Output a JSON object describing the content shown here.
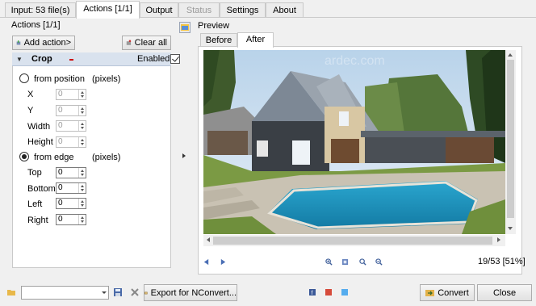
{
  "tabs": [
    {
      "label": "Input: 53 file(s)"
    },
    {
      "label": "Actions [1/1]"
    },
    {
      "label": "Output"
    },
    {
      "label": "Status"
    },
    {
      "label": "Settings"
    },
    {
      "label": "About"
    }
  ],
  "actions_panel": {
    "title": "Actions [1/1]",
    "add_action": "Add action>",
    "clear_all": "Clear all",
    "crop": {
      "name": "Crop",
      "enabled_label": "Enabled",
      "enabled": true,
      "from_position": {
        "label": "from position",
        "unit": "(pixels)",
        "fields": [
          {
            "label": "X",
            "value": "0"
          },
          {
            "label": "Y",
            "value": "0"
          },
          {
            "label": "Width",
            "value": "0"
          },
          {
            "label": "Height",
            "value": "0"
          }
        ]
      },
      "from_edge": {
        "label": "from edge",
        "unit": "(pixels)",
        "fields": [
          {
            "label": "Top",
            "value": "0"
          },
          {
            "label": "Bottom",
            "value": "0"
          },
          {
            "label": "Left",
            "value": "0"
          },
          {
            "label": "Right",
            "value": "0"
          }
        ]
      }
    }
  },
  "preview": {
    "title": "Preview",
    "tabs": [
      {
        "label": "Before"
      },
      {
        "label": "After"
      }
    ],
    "watermark": "ardec.com",
    "counter": "19/53 [51%]"
  },
  "bottom": {
    "combo_value": "",
    "export_label": "Export for NConvert...",
    "convert_label": "Convert",
    "close_label": "Close"
  },
  "colors": {
    "header_bg": "#d9e2ee",
    "pool_water": "#1f8fb5",
    "sky": "#cfe0f0"
  }
}
